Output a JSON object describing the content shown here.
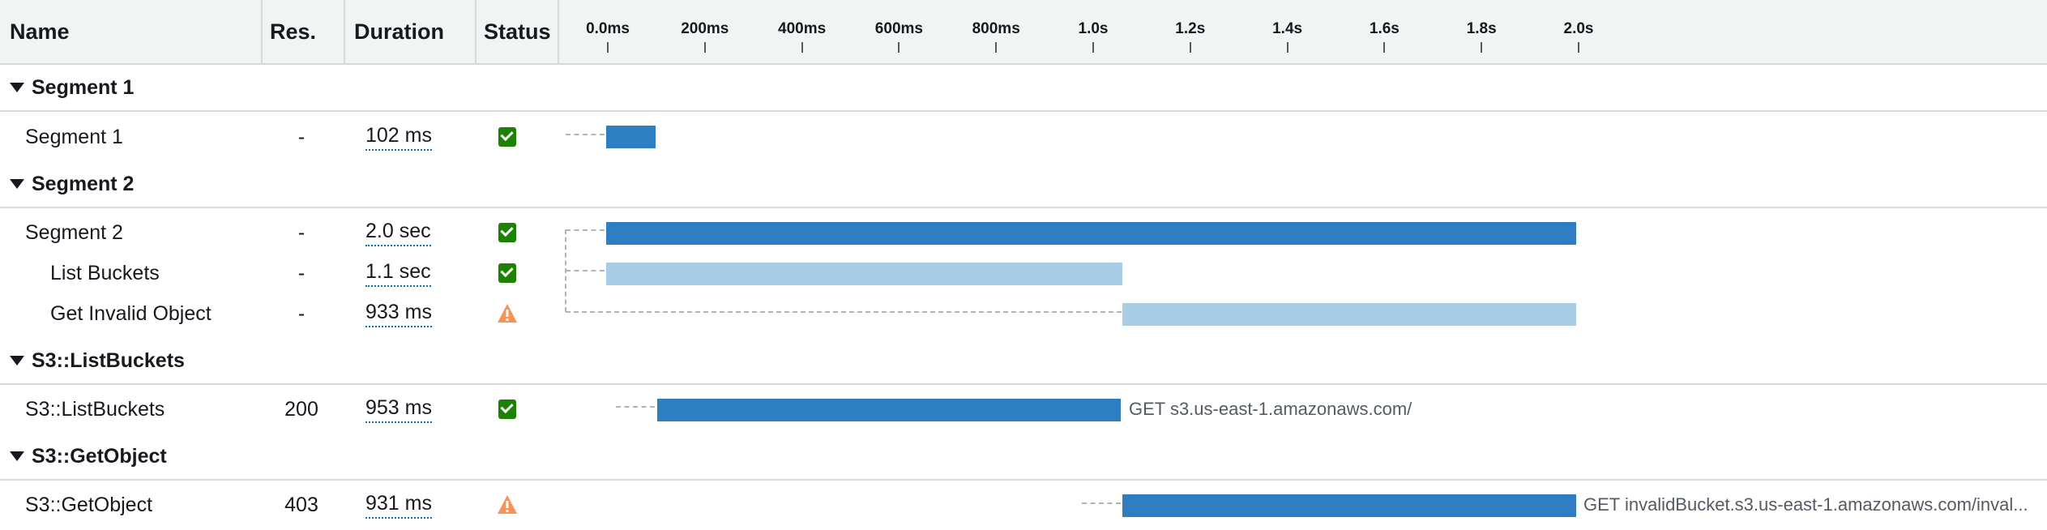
{
  "columns": {
    "name": "Name",
    "res": "Res.",
    "duration": "Duration",
    "status": "Status"
  },
  "timeline_ticks": [
    "0.0ms",
    "200ms",
    "400ms",
    "600ms",
    "800ms",
    "1.0s",
    "1.2s",
    "1.4s",
    "1.6s",
    "1.8s",
    "2.0s"
  ],
  "groups": [
    {
      "title": "Segment 1",
      "rows": [
        {
          "name": "Segment 1",
          "res": "-",
          "duration": "102 ms",
          "status": "ok"
        }
      ]
    },
    {
      "title": "Segment 2",
      "rows": [
        {
          "name": "Segment 2",
          "res": "-",
          "duration": "2.0 sec",
          "status": "ok"
        },
        {
          "name": "List Buckets",
          "res": "-",
          "duration": "1.1 sec",
          "status": "ok"
        },
        {
          "name": "Get Invalid Object",
          "res": "-",
          "duration": "933 ms",
          "status": "warning"
        }
      ]
    },
    {
      "title": "S3::ListBuckets",
      "rows": [
        {
          "name": "S3::ListBuckets",
          "res": "200",
          "duration": "953 ms",
          "status": "ok",
          "url": "GET s3.us-east-1.amazonaws.com/"
        }
      ]
    },
    {
      "title": "S3::GetObject",
      "rows": [
        {
          "name": "S3::GetObject",
          "res": "403",
          "duration": "931 ms",
          "status": "warning",
          "url": "GET invalidBucket.s3.us-east-1.amazonaws.com/inval..."
        }
      ]
    }
  ],
  "colors": {
    "bar_primary": "#2d7fc1",
    "bar_secondary": "#a9cde5",
    "status_ok": "#1d8102",
    "status_warning": "#f89256"
  }
}
